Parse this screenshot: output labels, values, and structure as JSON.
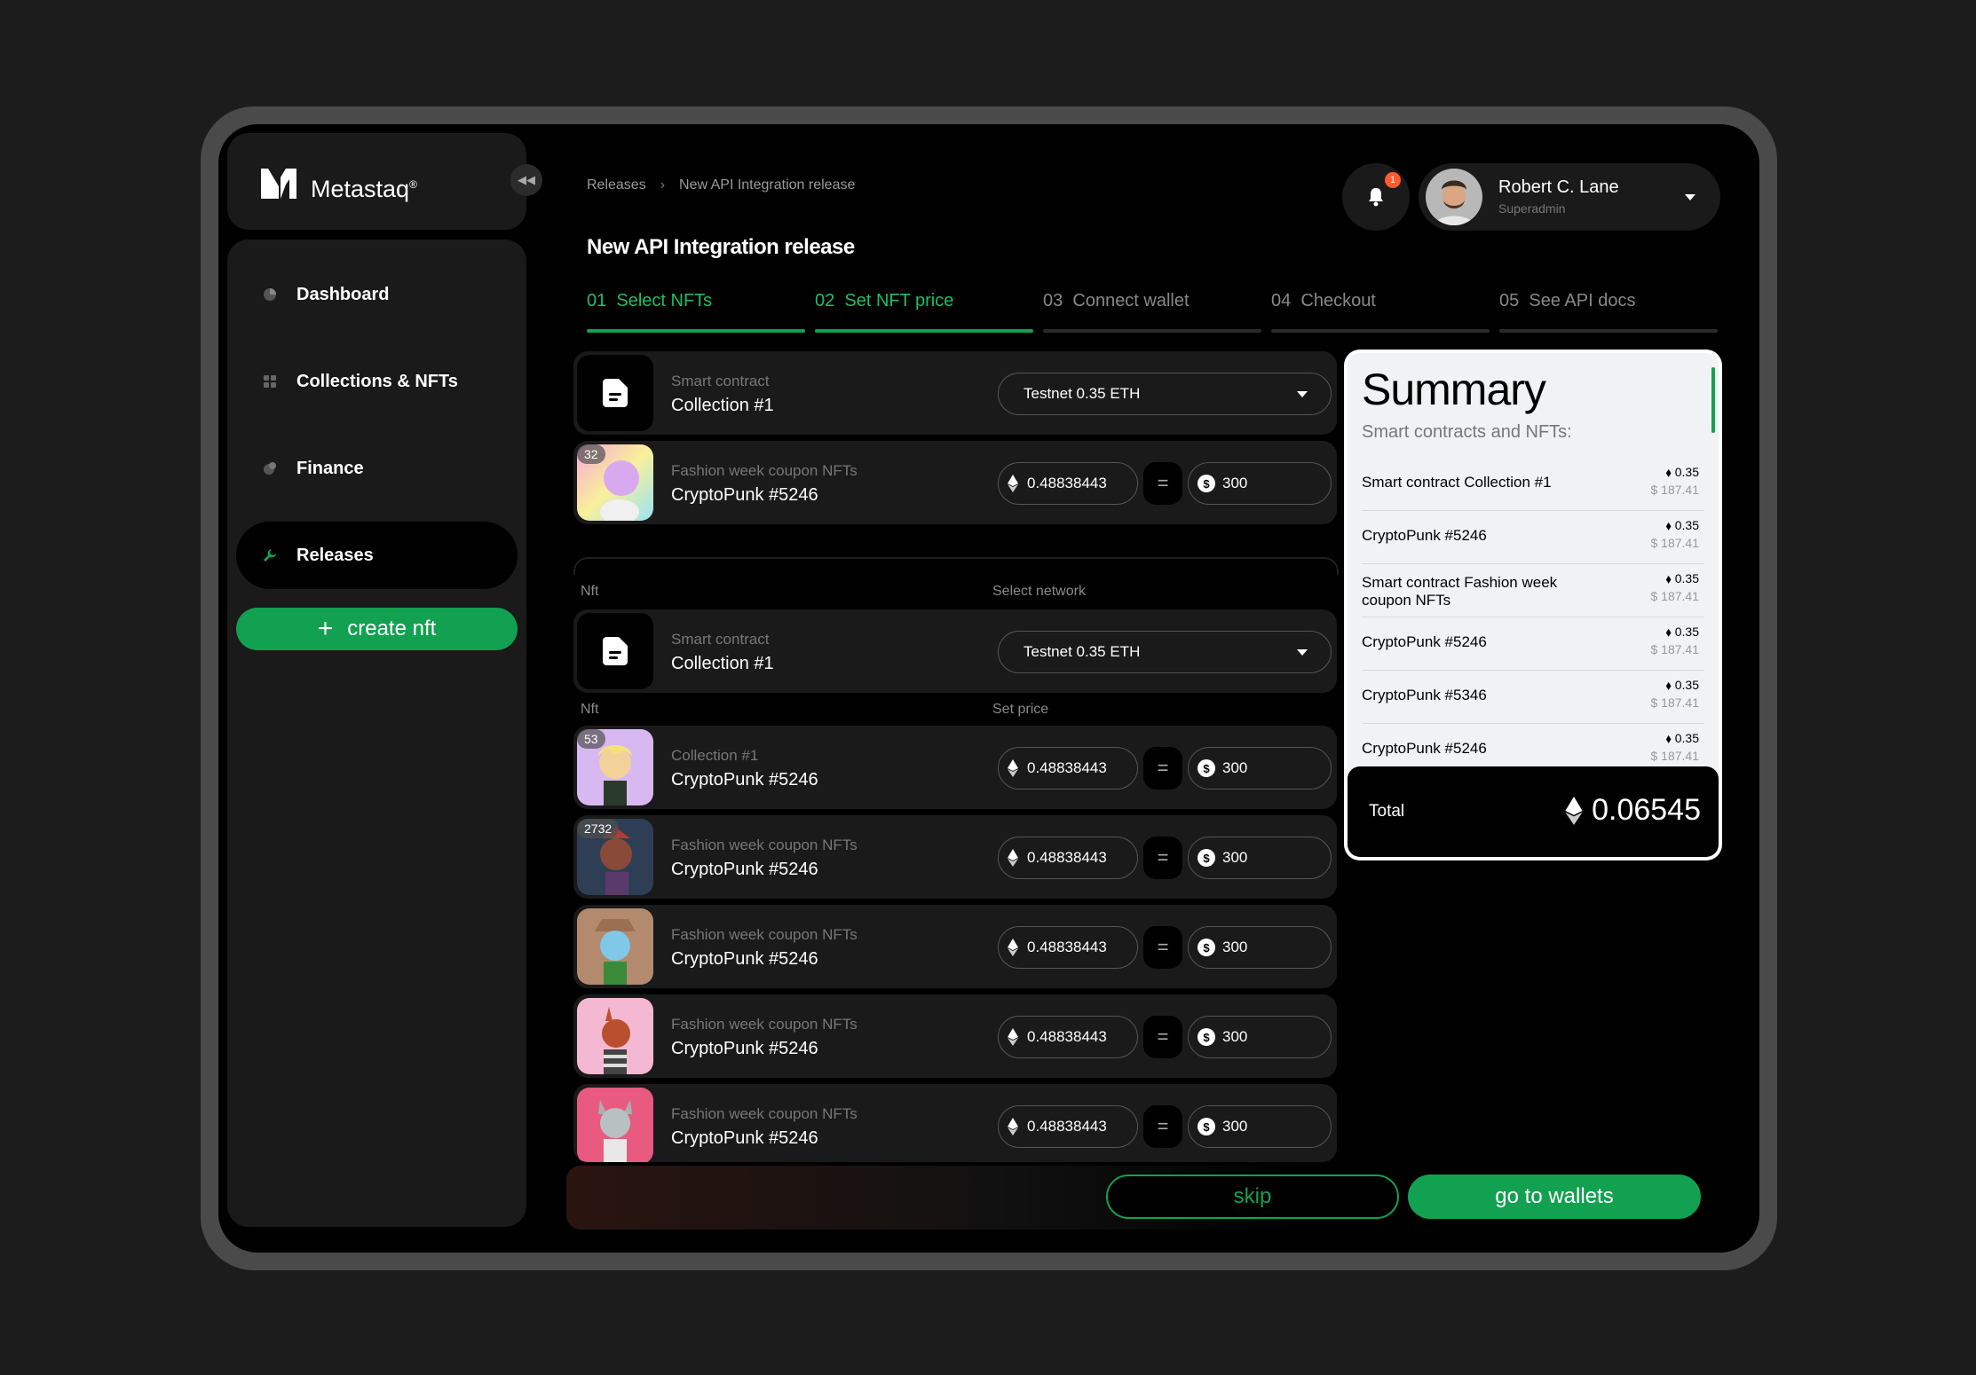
{
  "brand": {
    "name": "Metastaq",
    "mark": "®"
  },
  "sidebar": {
    "items": [
      {
        "label": "Dashboard",
        "icon": "dashboard-icon"
      },
      {
        "label": "Collections & NFTs",
        "icon": "grid-icon"
      },
      {
        "label": "Finance",
        "icon": "finance-icon"
      },
      {
        "label": "Releases",
        "icon": "wrench-icon",
        "active": true
      }
    ],
    "create_label": "create nft"
  },
  "breadcrumb": {
    "root": "Releases",
    "current": "New API Integration release"
  },
  "page_title": "New API Integration release",
  "notifications": {
    "count": "1"
  },
  "user": {
    "name": "Robert C. Lane",
    "role": "Superadmin"
  },
  "steps": [
    {
      "number": "01",
      "label": "Select NFTs",
      "done": true
    },
    {
      "number": "02",
      "label": "Set NFT price",
      "done": true
    },
    {
      "number": "03",
      "label": "Connect wallet",
      "done": false
    },
    {
      "number": "04",
      "label": "Checkout",
      "done": false
    },
    {
      "number": "05",
      "label": "See API docs",
      "done": false
    }
  ],
  "group1": {
    "contract": {
      "sub": "Smart contract",
      "title": "Collection #1",
      "network": "Testnet 0.35 ETH"
    },
    "nft": {
      "badge": "32",
      "sub": "Fashion week coupon NFTs",
      "title": "CryptoPunk #5246",
      "eth": "0.48838443",
      "usd": "300"
    }
  },
  "group2": {
    "nft_label": "Nft",
    "network_label": "Select network",
    "contract": {
      "sub": "Smart contract",
      "title": "Collection #1",
      "network": "Testnet 0.35 ETH"
    },
    "nft_label2": "Nft",
    "price_label": "Set price",
    "nfts": [
      {
        "badge": "53",
        "sub": "Collection #1",
        "title": "CryptoPunk #5246",
        "eth": "0.48838443",
        "usd": "300"
      },
      {
        "badge": "2732",
        "sub": "Fashion week coupon NFTs",
        "title": "CryptoPunk #5246",
        "eth": "0.48838443",
        "usd": "300"
      },
      {
        "badge": "",
        "sub": "Fashion week coupon NFTs",
        "title": "CryptoPunk #5246",
        "eth": "0.48838443",
        "usd": "300"
      },
      {
        "badge": "",
        "sub": "Fashion week coupon NFTs",
        "title": "CryptoPunk #5246",
        "eth": "0.48838443",
        "usd": "300"
      },
      {
        "badge": "",
        "sub": "Fashion week coupon NFTs",
        "title": "CryptoPunk #5246",
        "eth": "0.48838443",
        "usd": "300"
      }
    ]
  },
  "summary": {
    "title": "Summary",
    "subtitle": "Smart contracts and NFTs:",
    "items": [
      {
        "name": "Smart contract Collection #1",
        "eth": "0.35",
        "usd": "$ 187.41"
      },
      {
        "name": "CryptoPunk #5246",
        "eth": "0.35",
        "usd": "$ 187.41"
      },
      {
        "name": "Smart contract Fashion week coupon NFTs",
        "eth": "0.35",
        "usd": "$ 187.41"
      },
      {
        "name": "CryptoPunk #5246",
        "eth": "0.35",
        "usd": "$ 187.41"
      },
      {
        "name": "CryptoPunk #5346",
        "eth": "0.35",
        "usd": "$ 187.41"
      },
      {
        "name": "CryptoPunk #5246",
        "eth": "0.35",
        "usd": "$ 187.41"
      }
    ],
    "total_label": "Total",
    "total_value": "0.06545"
  },
  "actions": {
    "skip": "skip",
    "go": "go to wallets"
  },
  "colors": {
    "accent": "#12a150",
    "badge": "#ff5b2b",
    "background": "#000000"
  }
}
